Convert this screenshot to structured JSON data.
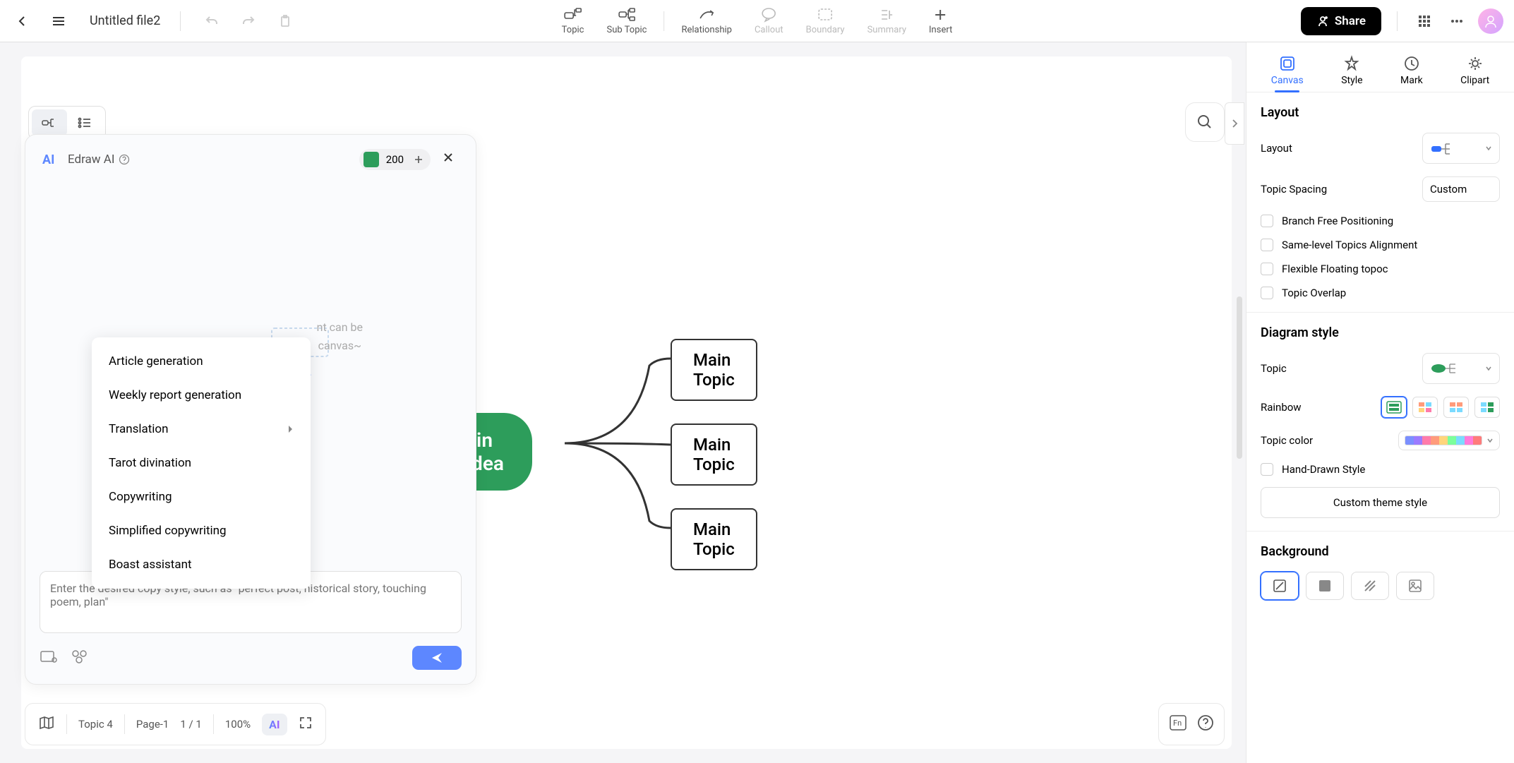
{
  "header": {
    "title": "Untitled file2",
    "share_label": "Share"
  },
  "tools": {
    "topic": "Topic",
    "sub_topic": "Sub Topic",
    "relationship": "Relationship",
    "callout": "Callout",
    "boundary": "Boundary",
    "summary": "Summary",
    "insert": "Insert"
  },
  "ai": {
    "title": "Edraw AI",
    "count": "200",
    "placeholder": "Enter the desired copy style, such as \"perfect post, historical story, touching poem, plan\"",
    "menu": {
      "article": "Article generation",
      "weekly": "Weekly report generation",
      "translation": "Translation",
      "tarot": "Tarot divination",
      "copywriting": "Copywriting",
      "simplified": "Simplified copywriting",
      "boast": "Boast assistant"
    },
    "hint1": "nt can be",
    "hint2": "canvas~"
  },
  "mindmap": {
    "main_idea": "ain Idea",
    "topic1": "Main Topic",
    "topic2": "Main Topic",
    "topic3": "Main Topic"
  },
  "panel": {
    "tabs": {
      "canvas": "Canvas",
      "style": "Style",
      "mark": "Mark",
      "clipart": "Clipart"
    },
    "layout_section": "Layout",
    "layout_label": "Layout",
    "topic_spacing": "Topic Spacing",
    "custom": "Custom",
    "branch_free": "Branch Free Positioning",
    "same_level": "Same-level Topics Alignment",
    "flexible": "Flexible Floating topoc",
    "overlap": "Topic Overlap",
    "diagram_style": "Diagram style",
    "topic_label": "Topic",
    "rainbow": "Rainbow",
    "topic_color": "Topic color",
    "hand_drawn": "Hand-Drawn Style",
    "custom_theme": "Custom theme style",
    "background": "Background"
  },
  "bottom": {
    "topic_count": "Topic 4",
    "page": "Page-1",
    "page_num": "1 / 1",
    "zoom": "100%",
    "ai_label": "AI"
  },
  "colors": {
    "strip": [
      "#7b8fff",
      "#9b7bff",
      "#ff7baa",
      "#ff9b7b",
      "#ffd57b",
      "#7bff9b",
      "#7bdbff",
      "#ff7bdb",
      "#ff7b7b"
    ]
  }
}
